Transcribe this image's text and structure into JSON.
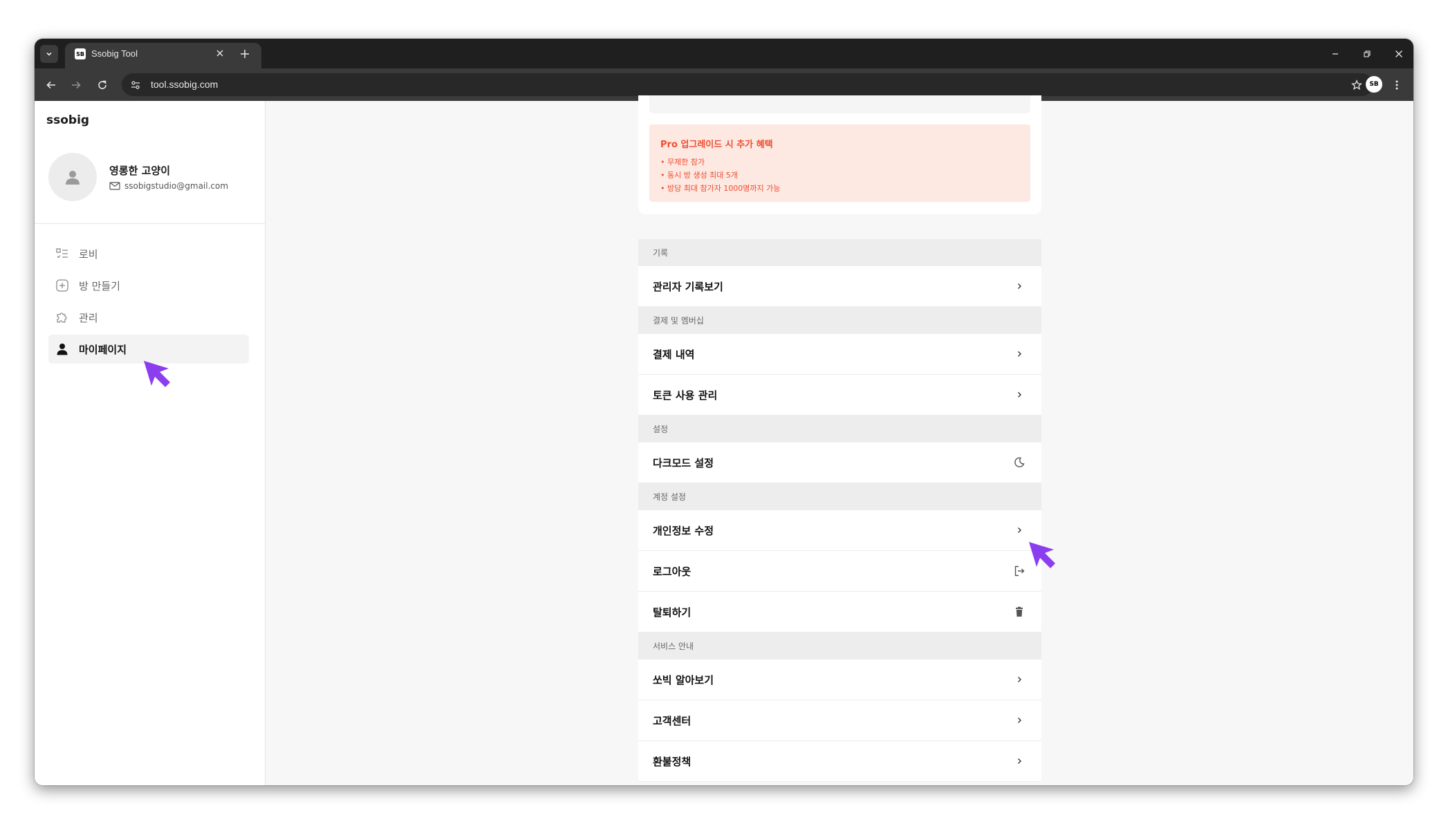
{
  "browser": {
    "tab_title": "Ssobig Tool",
    "favicon_text": "SB",
    "url": "tool.ssobig.com"
  },
  "sidebar": {
    "brand": "ssobig",
    "profile": {
      "name": "영롱한 고양이",
      "email": "ssobigstudio@gmail.com"
    },
    "nav": [
      {
        "label": "로비",
        "icon": "list-icon",
        "active": false
      },
      {
        "label": "방 만들기",
        "icon": "plus-square-icon",
        "active": false
      },
      {
        "label": "관리",
        "icon": "puzzle-icon",
        "active": false
      },
      {
        "label": "마이페이지",
        "icon": "user-icon",
        "active": true
      }
    ]
  },
  "upgrade": {
    "title": "Pro 업그레이드 시 추가 혜택",
    "items": [
      "• 무제한 참가",
      "• 동시 방 생성 최대 5개",
      "• 방당 최대 참가자 1000명까지 가능"
    ]
  },
  "menu": {
    "sections": [
      {
        "title": "기록",
        "rows": [
          {
            "label": "관리자 기록보기",
            "icon": "chevron-right-icon"
          }
        ]
      },
      {
        "title": "결제 및 멤버십",
        "rows": [
          {
            "label": "결제 내역",
            "icon": "chevron-right-icon"
          },
          {
            "label": "토큰 사용 관리",
            "icon": "chevron-right-icon"
          }
        ]
      },
      {
        "title": "설정",
        "rows": [
          {
            "label": "다크모드 설정",
            "icon": "moon-icon"
          }
        ]
      },
      {
        "title": "계정 설정",
        "rows": [
          {
            "label": "개인정보 수정",
            "icon": "chevron-right-icon"
          },
          {
            "label": "로그아웃",
            "icon": "logout-icon"
          },
          {
            "label": "탈퇴하기",
            "icon": "trash-icon"
          }
        ]
      },
      {
        "title": "서비스 안내",
        "rows": [
          {
            "label": "쏘빅 알아보기",
            "icon": "chevron-right-icon"
          },
          {
            "label": "고객센터",
            "icon": "chevron-right-icon"
          },
          {
            "label": "환불정책",
            "icon": "chevron-right-icon"
          }
        ]
      }
    ]
  },
  "colors": {
    "accent": "#ef4d2e",
    "pro_bg": "#fde8e2",
    "cursor": "#8b3df0"
  }
}
